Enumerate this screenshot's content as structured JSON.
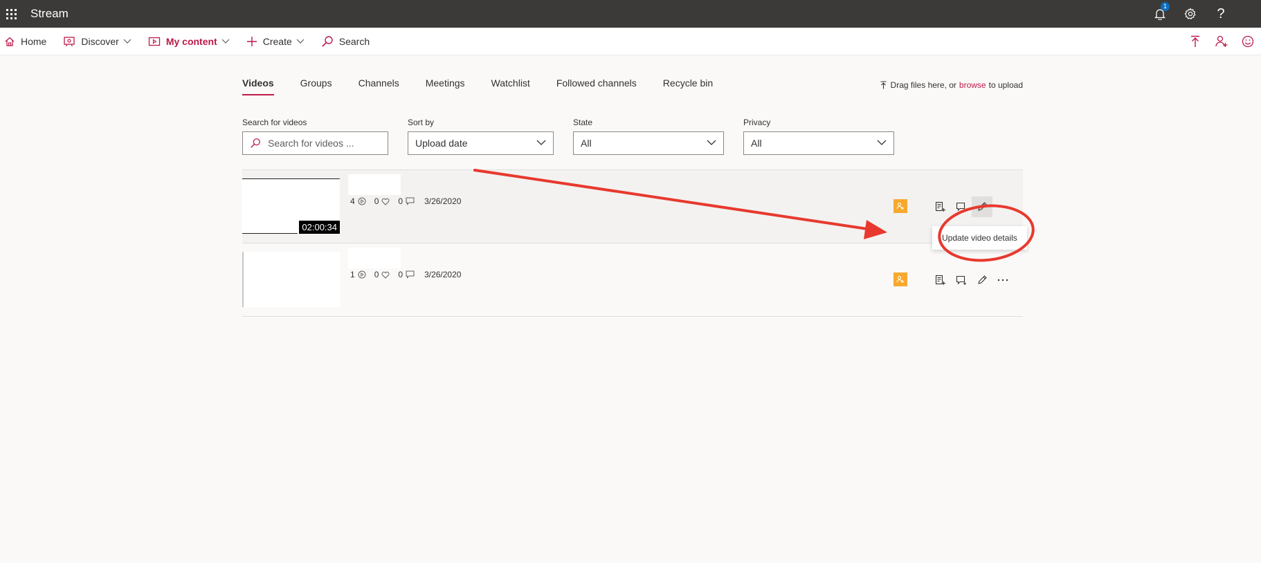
{
  "suitebar": {
    "app_name": "Stream",
    "notification_count": "1",
    "help_label": "?"
  },
  "nav": {
    "items": [
      {
        "label": "Home",
        "icon": "home-icon"
      },
      {
        "label": "Discover",
        "icon": "discover-icon"
      },
      {
        "label": "My content",
        "icon": "my-content-icon"
      },
      {
        "label": "Create",
        "icon": "plus-icon"
      },
      {
        "label": "Search",
        "icon": "search-icon"
      }
    ],
    "right_icons": [
      "upload-icon",
      "add-person-icon",
      "smiley-icon"
    ]
  },
  "tabs": [
    {
      "label": "Videos",
      "active": true
    },
    {
      "label": "Groups"
    },
    {
      "label": "Channels"
    },
    {
      "label": "Meetings"
    },
    {
      "label": "Watchlist"
    },
    {
      "label": "Followed channels"
    },
    {
      "label": "Recycle bin"
    }
  ],
  "upload": {
    "prefix": "Drag files here, or",
    "link": "browse",
    "suffix": "to upload"
  },
  "filters": {
    "search": {
      "label": "Search for videos",
      "placeholder": "Search for videos ..."
    },
    "sort": {
      "label": "Sort by",
      "value": "Upload date"
    },
    "state": {
      "label": "State",
      "value": "All"
    },
    "privacy": {
      "label": "Privacy",
      "value": "All"
    }
  },
  "videos": [
    {
      "duration": "02:00:34",
      "views": "4",
      "likes": "0",
      "comments": "0",
      "date": "3/26/2020"
    },
    {
      "views": "1",
      "likes": "0",
      "comments": "0",
      "date": "3/26/2020"
    }
  ],
  "tooltip": {
    "text": "Update video details"
  },
  "colors": {
    "accent": "#bc1948",
    "annotation": "#e8392e",
    "badge": "#f7a92e",
    "suitebar": "#3b3a39"
  }
}
